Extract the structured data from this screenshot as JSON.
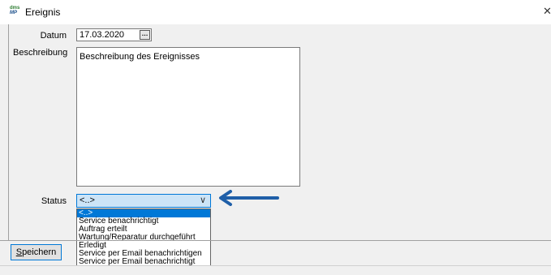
{
  "window": {
    "title": "Ereignis",
    "icon_line1": "dms",
    "icon_line2": "MP",
    "close_glyph": "✕"
  },
  "form": {
    "date_label": "Datum",
    "date_value": "17.03.2020",
    "date_button": "…",
    "description_label": "Beschreibung",
    "description_value": "Beschreibung des Ereignisses",
    "status_label": "Status",
    "status_value": "<..>",
    "status_chevron": "∨"
  },
  "status_options": [
    "<..>",
    "Service benachrichtigt",
    "Auftrag erteilt",
    "Wartung/Reparatur durchgeführt",
    "Erledigt",
    "Service per Email benachrichtigen",
    "Service per Email benachrichtigt"
  ],
  "status_selected_index": 0,
  "buttons": {
    "save_mnemonic": "S",
    "save_rest": "peichern"
  },
  "colors": {
    "accent": "#0078d7",
    "arrow": "#1f5fa8",
    "select_bg": "#cce4f7"
  },
  "icons": {
    "annotation": "arrow-left-icon",
    "calendar": "ellipsis-icon",
    "dropdown": "chevron-down-icon",
    "close": "close-icon"
  }
}
